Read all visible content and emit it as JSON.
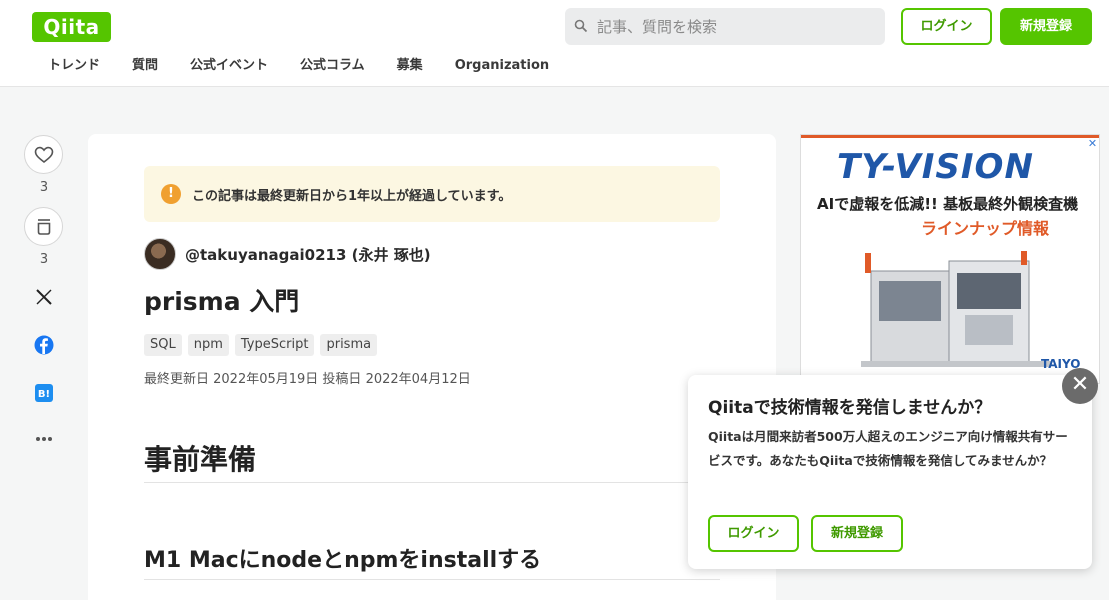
{
  "header": {
    "logo": "Qiita",
    "search_placeholder": "記事、質問を検索",
    "login_label": "ログイン",
    "signup_label": "新規登録",
    "nav": [
      "トレンド",
      "質問",
      "公式イベント",
      "公式コラム",
      "募集",
      "Organization"
    ]
  },
  "actions": {
    "like_count": "3",
    "stock_count": "3",
    "icons": [
      "heart-icon",
      "stock-icon",
      "x-icon",
      "facebook-icon",
      "hatena-bookmark-icon",
      "more-icon"
    ]
  },
  "article": {
    "notice_icon": "!",
    "notice": "この記事は最終更新日から1年以上が経過しています。",
    "author": "@takuyanagai0213 (永井 琢也)",
    "title": "prisma 入門",
    "tags": [
      "SQL",
      "npm",
      "TypeScript",
      "prisma"
    ],
    "dates": "最終更新日 2022年05月19日  投稿日 2022年04月12日",
    "heading1": "事前準備",
    "heading2": "M1 Macにnodeとnpmをinstallする"
  },
  "ad": {
    "brand": "TY-VISION",
    "line1": "AIで虚報を低減!! 基板最終外観検査機",
    "line2": "ラインナップ情報",
    "logo": "TAIYO",
    "close": "✕"
  },
  "popup": {
    "title": "Qiitaで技術情報を発信しませんか？",
    "body": "Qiitaは月間来訪者500万人超えのエンジニア向け情報共有サービスです。あなたもQiitaで技術情報を発信してみませんか？",
    "login_label": "ログイン",
    "signup_label": "新規登録",
    "close": "✕"
  },
  "colors": {
    "accent": "#55c500",
    "notice_bg": "#fcf7e2",
    "ad_orange": "#e05a28",
    "ad_blue": "#1f57a8"
  }
}
